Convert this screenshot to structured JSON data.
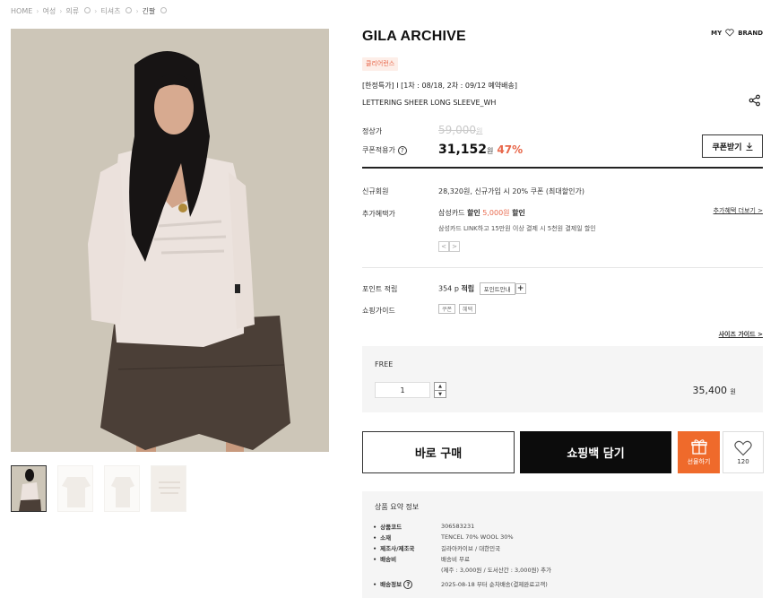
{
  "breadcrumb": {
    "home": "HOME",
    "cat1": "여성",
    "cat2": "의류",
    "cat3": "티셔츠",
    "cat4": "긴팔"
  },
  "header": {
    "brand": "GILA ARCHIVE",
    "my_label": "MY",
    "brand_label": "BRAND"
  },
  "product": {
    "badge": "클리어런스",
    "promo": "[한정특가] I [1차 : 08/18, 2차 : 09/12 예약배송]",
    "name": "LETTERING SHEER LONG SLEEVE_WH"
  },
  "price": {
    "original_label": "정상가",
    "original_value": "59,000",
    "original_unit": "원",
    "coupon_label": "쿠폰적용가",
    "sale_value": "31,152",
    "sale_unit": "원",
    "discount": "47%",
    "coupon_button": "쿠폰받기"
  },
  "benefits": {
    "new_member_label": "신규회원",
    "new_member_value": "28,320원, 신규가입 시 20% 쿠폰 (최대할인가)",
    "extra_label": "추가혜택가",
    "extra_prefix": "삼성카드",
    "extra_bold1": "할인",
    "extra_amount": "5,000원",
    "extra_bold2": "할인",
    "extra_note": "삼성카드 LINK하고 15만원 이상 결제 시 5천원 결제일 할인",
    "more_link": "추가혜택 더보기 >",
    "prev": "<",
    "next": ">"
  },
  "points": {
    "label": "포인트 적립",
    "amount": "354 p",
    "suffix": "적립",
    "guide_button": "포인트안내",
    "plus": "+"
  },
  "shopping_guide": {
    "label": "쇼핑가이드",
    "tag1": "쿠폰",
    "tag2": "혜택"
  },
  "size_guide": "사이즈 가이드 >",
  "option": {
    "label": "FREE",
    "quantity": "1",
    "price": "35,400",
    "unit": "원"
  },
  "actions": {
    "buy_now": "바로 구매",
    "add_to_bag": "쇼핑백 담기",
    "gift": "선물하기",
    "like_count": "120"
  },
  "summary": {
    "title": "상품 요약 정보",
    "rows": [
      {
        "k": "상품코드",
        "v": "306583231"
      },
      {
        "k": "소재",
        "v": "TENCEL 70% WOOL 30%"
      },
      {
        "k": "제조사/제조국",
        "v": "길라아카이브 / 대한민국"
      },
      {
        "k": "배송비",
        "v": "배송비 무료"
      },
      {
        "k": "",
        "v": "(제주 : 3,000원 / 도서산간 : 3,000원) 추가"
      },
      {
        "k": "배송정보",
        "v": "2025-08-18 부터 순차배송(결제완료고객)"
      }
    ]
  },
  "colors": {
    "accent": "#e8674a",
    "gift": "#ef6a2b",
    "dark": "#0c0c0c"
  }
}
